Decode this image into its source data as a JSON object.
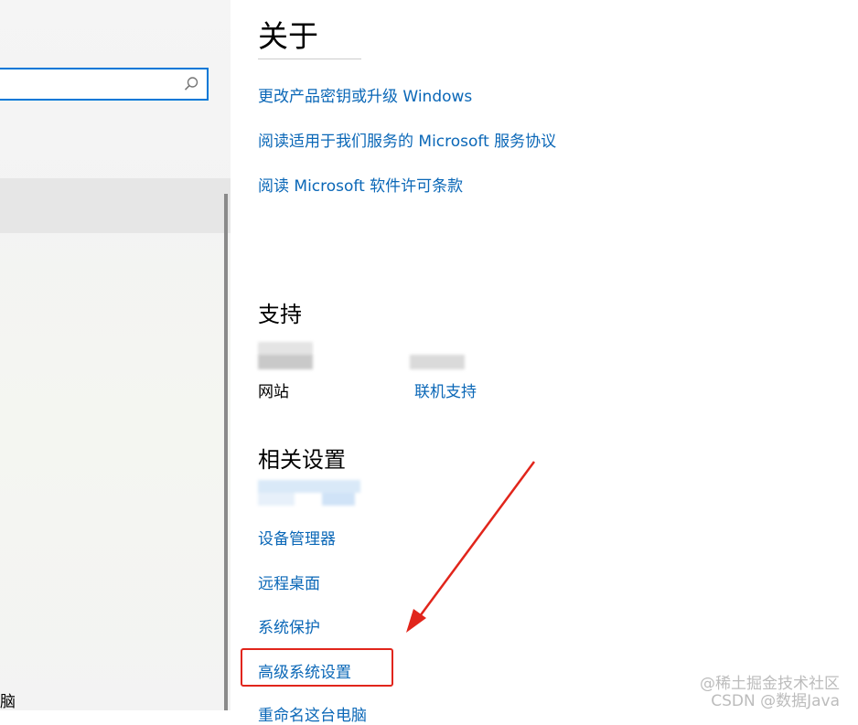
{
  "left_pane": {
    "search": {
      "value": "",
      "placeholder": ""
    },
    "bottom_text": "脑"
  },
  "about": {
    "title": "关于",
    "links": [
      "更改产品密钥或升级 Windows",
      "阅读适用于我们服务的 Microsoft 服务协议",
      "阅读 Microsoft 软件许可条款"
    ]
  },
  "support": {
    "title": "支持",
    "website_label": "网站",
    "online_support_link": "联机支持"
  },
  "related": {
    "title": "相关设置",
    "links": {
      "device_manager": "设备管理器",
      "remote_desktop": "远程桌面",
      "system_protection": "系统保护",
      "advanced_settings": "高级系统设置",
      "rename_partial": "重命名这台电脑"
    }
  },
  "watermark": {
    "line1": "@稀土掘金技术社区",
    "line2": "CSDN @数据Java"
  },
  "colors": {
    "link": "#0a67b7",
    "highlight": "#e1251b",
    "accent": "#0078d7"
  }
}
